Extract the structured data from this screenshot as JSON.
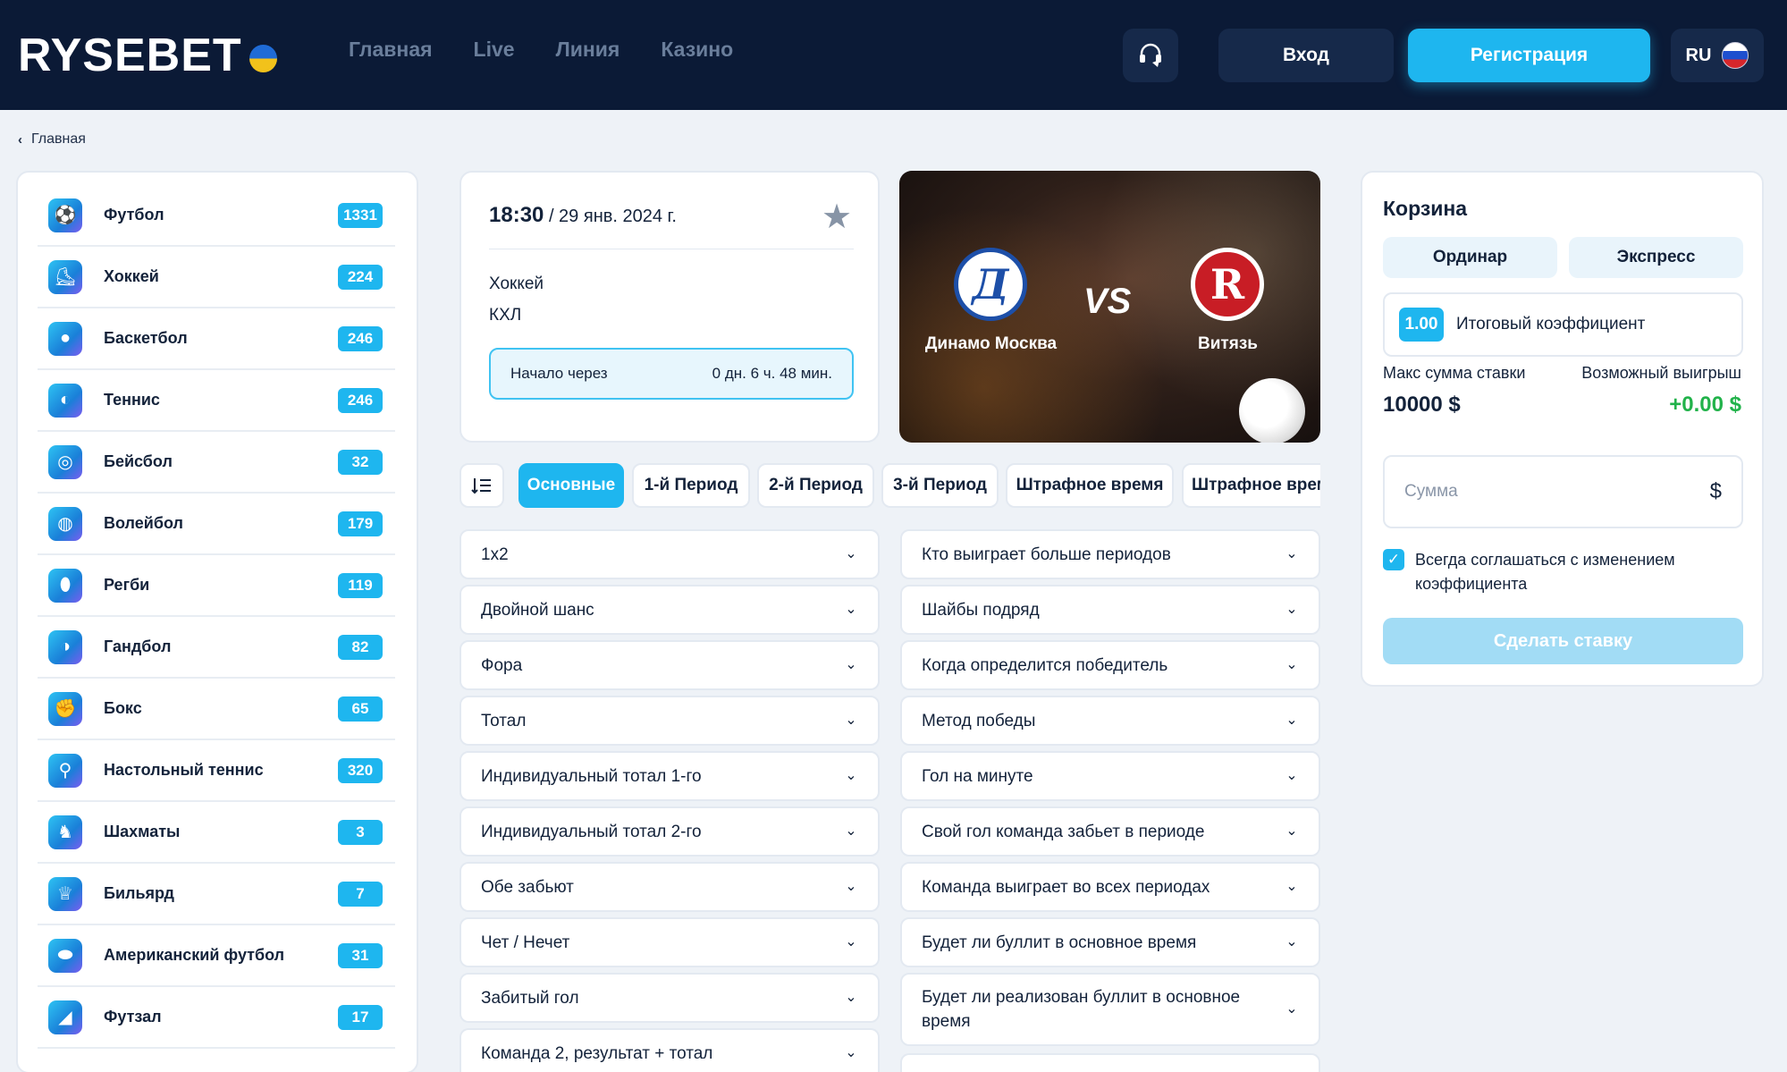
{
  "header": {
    "logo": "RYSEBET",
    "nav": [
      "Главная",
      "Live",
      "Линия",
      "Казино"
    ],
    "login_label": "Вход",
    "register_label": "Регистрация",
    "language": "RU"
  },
  "breadcrumb": {
    "label": "Главная"
  },
  "sidebar": {
    "items": [
      {
        "label": "Футбол",
        "count": "1331",
        "icon": "soccer-ball-icon"
      },
      {
        "label": "Хоккей",
        "count": "224",
        "icon": "hockey-skate-icon"
      },
      {
        "label": "Баскетбол",
        "count": "246",
        "icon": "basketball-icon"
      },
      {
        "label": "Теннис",
        "count": "246",
        "icon": "tennis-ball-icon"
      },
      {
        "label": "Бейсбол",
        "count": "32",
        "icon": "baseball-icon"
      },
      {
        "label": "Волейбол",
        "count": "179",
        "icon": "volleyball-icon"
      },
      {
        "label": "Регби",
        "count": "119",
        "icon": "rugby-ball-icon"
      },
      {
        "label": "Гандбол",
        "count": "82",
        "icon": "handball-icon"
      },
      {
        "label": "Бокс",
        "count": "65",
        "icon": "boxing-glove-icon"
      },
      {
        "label": "Настольный теннис",
        "count": "320",
        "icon": "table-tennis-icon"
      },
      {
        "label": "Шахматы",
        "count": "3",
        "icon": "chess-board-icon"
      },
      {
        "label": "Бильярд",
        "count": "7",
        "icon": "trophy-icon"
      },
      {
        "label": "Американский футбол",
        "count": "31",
        "icon": "american-football-icon"
      },
      {
        "label": "Футзал",
        "count": "17",
        "icon": "futsal-shoe-icon"
      }
    ]
  },
  "event": {
    "time": "18:30",
    "date": " / 29 янв. 2024 г.",
    "sport": "Хоккей",
    "league": "КХЛ",
    "countdown_label": "Начало через",
    "countdown_value": "0 дн. 6 ч. 48 мин."
  },
  "match": {
    "home_team": "Динамо Москва",
    "away_team": "Витязь",
    "vs": "VS",
    "home_logo_letter": "Д",
    "away_logo_letter": "R"
  },
  "tabs": [
    "Основные",
    "1-й Период",
    "2-й Период",
    "3-й Период",
    "Штрафное время",
    "Штрафное время"
  ],
  "markets_left": [
    "1x2",
    "Двойной шанс",
    "Фора",
    "Тотал",
    "Индивидуальный тотал 1-го",
    "Индивидуальный тотал 2-го",
    "Обе забьют",
    "Чет / Нечет",
    "Забитый гол",
    "Команда 2, результат + тотал"
  ],
  "markets_right": [
    "Кто выиграет больше периодов",
    "Шайбы подряд",
    "Когда определится победитель",
    "Метод победы",
    "Гол на минуте",
    "Свой гол команда забьет в периоде",
    "Команда выиграет во всех периодах",
    "Будет ли буллит в основное время",
    "Будет ли реализован буллит в основное время"
  ],
  "cart": {
    "title": "Корзина",
    "tab_single": "Ординар",
    "tab_express": "Экспресс",
    "coef_value": "1.00",
    "coef_label": "Итоговый коэффициент",
    "max_label": "Макс сумма ставки",
    "win_label": "Возможный выигрыш",
    "max_value": "10000 $",
    "win_value": "+0.00 $",
    "amount_placeholder": "Сумма",
    "currency": "$",
    "agree_text": "Всегда соглашаться с изменением коэффициента",
    "agree_checked": true,
    "bet_label": "Сделать ставку"
  },
  "colors": {
    "header_bg": "#0b1a36",
    "accent": "#1eb6ef",
    "win_green": "#21b24a"
  }
}
